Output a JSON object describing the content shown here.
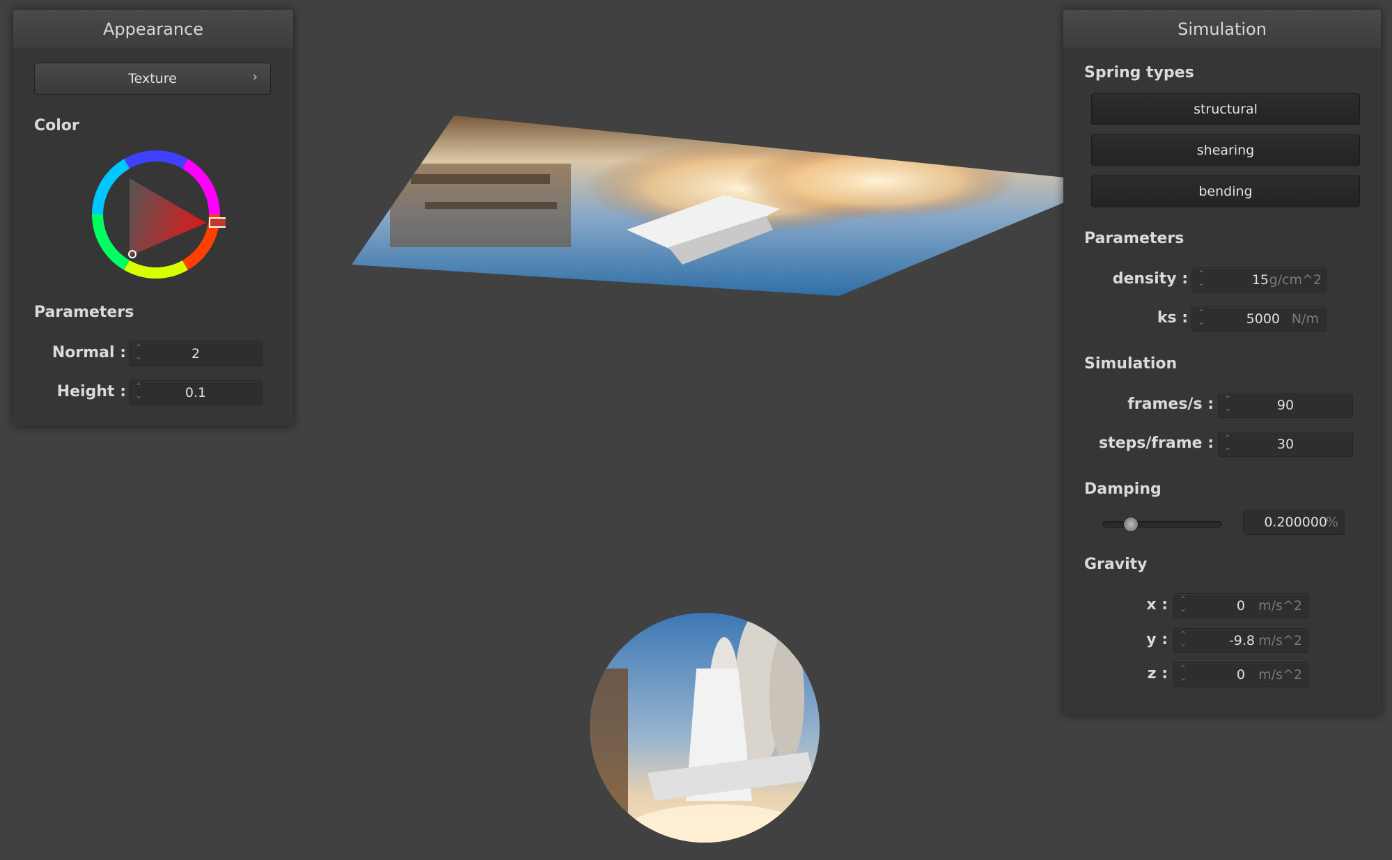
{
  "appearance": {
    "title": "Appearance",
    "texture_button": "Texture",
    "color_label": "Color",
    "parameters_label": "Parameters",
    "normal": {
      "label": "Normal :",
      "value": "2"
    },
    "height": {
      "label": "Height :",
      "value": "0.1"
    }
  },
  "simulation": {
    "title": "Simulation",
    "spring_types_label": "Spring types",
    "spring_types": [
      "structural",
      "shearing",
      "bending"
    ],
    "parameters_label": "Parameters",
    "density": {
      "label": "density :",
      "value": "15",
      "unit": "g/cm^2"
    },
    "ks": {
      "label": "ks :",
      "value": "5000",
      "unit": "N/m"
    },
    "simulation_label": "Simulation",
    "frames": {
      "label": "frames/s :",
      "value": "90"
    },
    "steps": {
      "label": "steps/frame :",
      "value": "30"
    },
    "damping_label": "Damping",
    "damping": {
      "value": "0.200000",
      "unit": "%",
      "slider_fraction": 0.2
    },
    "gravity_label": "Gravity",
    "gravity": {
      "x": {
        "label": "x :",
        "value": "0",
        "unit": "m/s^2"
      },
      "y": {
        "label": "y :",
        "value": "-9.8",
        "unit": "m/s^2"
      },
      "z": {
        "label": "z :",
        "value": "0",
        "unit": "m/s^2"
      }
    }
  },
  "icons": {
    "spinner": "spinner-arrows-icon",
    "chevron": "chevron-right-icon"
  },
  "colors": {
    "background": "#414141",
    "panel": "#363636",
    "selected_color": "#c0392b"
  }
}
